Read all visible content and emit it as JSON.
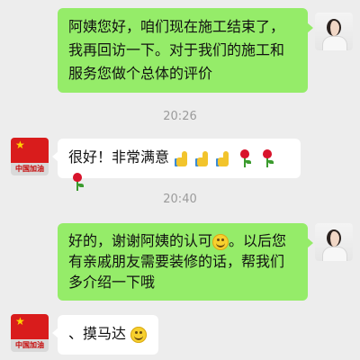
{
  "messages": [
    {
      "sender": "user",
      "text": "阿姨您好，咱们现在施工结束了，我再回访一下。对于我们的施工和服务您做个总体的评价"
    },
    {
      "sender": "customer",
      "text": "很好！非常满意",
      "emojis": [
        "thumbs-up",
        "thumbs-up",
        "thumbs-up",
        "rose",
        "rose",
        "rose"
      ]
    },
    {
      "sender": "user",
      "text": "好的，谢谢阿姨的认可",
      "emoji": "smile",
      "text_after": "。以后您有亲戚朋友需要装修的话，帮我们多介绍一下哦"
    },
    {
      "sender": "customer",
      "text": "、摸马达",
      "emoji": "smile"
    }
  ],
  "timestamps": [
    "20:26",
    "20:40"
  ],
  "customer_avatar_caption": "中国加油",
  "colors": {
    "sent_bubble": "#95ec69",
    "received_bubble": "#ffffff",
    "background": "#ededed"
  }
}
